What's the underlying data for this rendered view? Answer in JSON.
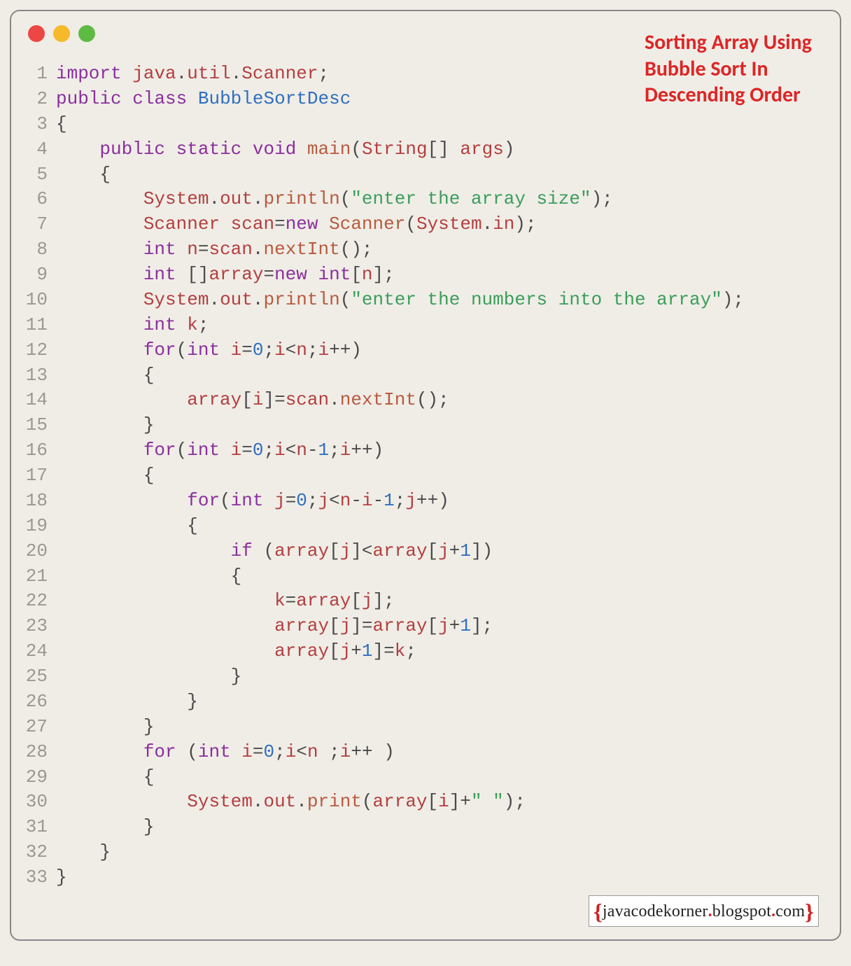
{
  "title_lines": [
    "Sorting Array Using",
    "Bubble Sort In",
    "Descending Order"
  ],
  "footer": {
    "open": "{",
    "text1": "javacodekorner",
    "dot": ".",
    "text2": "blogspot",
    "text3": "com",
    "close": "}"
  },
  "code": [
    {
      "n": "1",
      "tokens": [
        [
          "kw",
          "import"
        ],
        [
          "plain",
          " "
        ],
        [
          "ident",
          "java"
        ],
        [
          "punc",
          "."
        ],
        [
          "ident",
          "util"
        ],
        [
          "punc",
          "."
        ],
        [
          "ident",
          "Scanner"
        ],
        [
          "punc",
          ";"
        ]
      ]
    },
    {
      "n": "2",
      "tokens": [
        [
          "kw",
          "public"
        ],
        [
          "plain",
          " "
        ],
        [
          "kw",
          "class"
        ],
        [
          "plain",
          " "
        ],
        [
          "cls",
          "BubbleSortDesc"
        ]
      ]
    },
    {
      "n": "3",
      "tokens": [
        [
          "punc",
          "{"
        ]
      ]
    },
    {
      "n": "4",
      "tokens": [
        [
          "plain",
          "    "
        ],
        [
          "kw",
          "public"
        ],
        [
          "plain",
          " "
        ],
        [
          "kw",
          "static"
        ],
        [
          "plain",
          " "
        ],
        [
          "kw",
          "void"
        ],
        [
          "plain",
          " "
        ],
        [
          "fn",
          "main"
        ],
        [
          "punc",
          "("
        ],
        [
          "ident",
          "String"
        ],
        [
          "punc",
          "[] "
        ],
        [
          "ident",
          "args"
        ],
        [
          "punc",
          ")"
        ]
      ]
    },
    {
      "n": "5",
      "tokens": [
        [
          "plain",
          "    "
        ],
        [
          "punc",
          "{"
        ]
      ]
    },
    {
      "n": "6",
      "tokens": [
        [
          "plain",
          "        "
        ],
        [
          "ident",
          "System"
        ],
        [
          "punc",
          "."
        ],
        [
          "ident",
          "out"
        ],
        [
          "punc",
          "."
        ],
        [
          "fn",
          "println"
        ],
        [
          "punc",
          "("
        ],
        [
          "str",
          "\"enter the array size\""
        ],
        [
          "punc",
          ");"
        ]
      ]
    },
    {
      "n": "7",
      "tokens": [
        [
          "plain",
          "        "
        ],
        [
          "ident",
          "Scanner"
        ],
        [
          "plain",
          " "
        ],
        [
          "ident",
          "scan"
        ],
        [
          "op",
          "="
        ],
        [
          "kw",
          "new"
        ],
        [
          "plain",
          " "
        ],
        [
          "fn",
          "Scanner"
        ],
        [
          "punc",
          "("
        ],
        [
          "ident",
          "System"
        ],
        [
          "punc",
          "."
        ],
        [
          "ident",
          "in"
        ],
        [
          "punc",
          ");"
        ]
      ]
    },
    {
      "n": "8",
      "tokens": [
        [
          "plain",
          "        "
        ],
        [
          "kw",
          "int"
        ],
        [
          "plain",
          " "
        ],
        [
          "ident",
          "n"
        ],
        [
          "op",
          "="
        ],
        [
          "ident",
          "scan"
        ],
        [
          "punc",
          "."
        ],
        [
          "fn",
          "nextInt"
        ],
        [
          "punc",
          "();"
        ]
      ]
    },
    {
      "n": "9",
      "tokens": [
        [
          "plain",
          "        "
        ],
        [
          "kw",
          "int"
        ],
        [
          "plain",
          " []"
        ],
        [
          "ident",
          "array"
        ],
        [
          "op",
          "="
        ],
        [
          "kw",
          "new"
        ],
        [
          "plain",
          " "
        ],
        [
          "kw",
          "int"
        ],
        [
          "punc",
          "["
        ],
        [
          "ident",
          "n"
        ],
        [
          "punc",
          "];"
        ]
      ]
    },
    {
      "n": "10",
      "tokens": [
        [
          "plain",
          "        "
        ],
        [
          "ident",
          "System"
        ],
        [
          "punc",
          "."
        ],
        [
          "ident",
          "out"
        ],
        [
          "punc",
          "."
        ],
        [
          "fn",
          "println"
        ],
        [
          "punc",
          "("
        ],
        [
          "str",
          "\"enter the numbers into the array\""
        ],
        [
          "punc",
          ");"
        ]
      ]
    },
    {
      "n": "11",
      "tokens": [
        [
          "plain",
          "        "
        ],
        [
          "kw",
          "int"
        ],
        [
          "plain",
          " "
        ],
        [
          "ident",
          "k"
        ],
        [
          "punc",
          ";"
        ]
      ]
    },
    {
      "n": "12",
      "tokens": [
        [
          "plain",
          "        "
        ],
        [
          "kw",
          "for"
        ],
        [
          "punc",
          "("
        ],
        [
          "kw",
          "int"
        ],
        [
          "plain",
          " "
        ],
        [
          "ident",
          "i"
        ],
        [
          "op",
          "="
        ],
        [
          "num",
          "0"
        ],
        [
          "punc",
          ";"
        ],
        [
          "ident",
          "i"
        ],
        [
          "op",
          "<"
        ],
        [
          "ident",
          "n"
        ],
        [
          "punc",
          ";"
        ],
        [
          "ident",
          "i"
        ],
        [
          "op",
          "++"
        ],
        [
          "punc",
          ")"
        ]
      ]
    },
    {
      "n": "13",
      "tokens": [
        [
          "plain",
          "        "
        ],
        [
          "punc",
          "{"
        ]
      ]
    },
    {
      "n": "14",
      "tokens": [
        [
          "plain",
          "            "
        ],
        [
          "ident",
          "array"
        ],
        [
          "punc",
          "["
        ],
        [
          "ident",
          "i"
        ],
        [
          "punc",
          "]"
        ],
        [
          "op",
          "="
        ],
        [
          "ident",
          "scan"
        ],
        [
          "punc",
          "."
        ],
        [
          "fn",
          "nextInt"
        ],
        [
          "punc",
          "();"
        ]
      ]
    },
    {
      "n": "15",
      "tokens": [
        [
          "plain",
          "        "
        ],
        [
          "punc",
          "}"
        ]
      ]
    },
    {
      "n": "16",
      "tokens": [
        [
          "plain",
          "        "
        ],
        [
          "kw",
          "for"
        ],
        [
          "punc",
          "("
        ],
        [
          "kw",
          "int"
        ],
        [
          "plain",
          " "
        ],
        [
          "ident",
          "i"
        ],
        [
          "op",
          "="
        ],
        [
          "num",
          "0"
        ],
        [
          "punc",
          ";"
        ],
        [
          "ident",
          "i"
        ],
        [
          "op",
          "<"
        ],
        [
          "ident",
          "n"
        ],
        [
          "op",
          "-"
        ],
        [
          "num",
          "1"
        ],
        [
          "punc",
          ";"
        ],
        [
          "ident",
          "i"
        ],
        [
          "op",
          "++"
        ],
        [
          "punc",
          ")"
        ]
      ]
    },
    {
      "n": "17",
      "tokens": [
        [
          "plain",
          "        "
        ],
        [
          "punc",
          "{"
        ]
      ]
    },
    {
      "n": "18",
      "tokens": [
        [
          "plain",
          "            "
        ],
        [
          "kw",
          "for"
        ],
        [
          "punc",
          "("
        ],
        [
          "kw",
          "int"
        ],
        [
          "plain",
          " "
        ],
        [
          "ident",
          "j"
        ],
        [
          "op",
          "="
        ],
        [
          "num",
          "0"
        ],
        [
          "punc",
          ";"
        ],
        [
          "ident",
          "j"
        ],
        [
          "op",
          "<"
        ],
        [
          "ident",
          "n"
        ],
        [
          "op",
          "-"
        ],
        [
          "ident",
          "i"
        ],
        [
          "op",
          "-"
        ],
        [
          "num",
          "1"
        ],
        [
          "punc",
          ";"
        ],
        [
          "ident",
          "j"
        ],
        [
          "op",
          "++"
        ],
        [
          "punc",
          ")"
        ]
      ]
    },
    {
      "n": "19",
      "tokens": [
        [
          "plain",
          "            "
        ],
        [
          "punc",
          "{"
        ]
      ]
    },
    {
      "n": "20",
      "tokens": [
        [
          "plain",
          "                "
        ],
        [
          "kw",
          "if"
        ],
        [
          "plain",
          " "
        ],
        [
          "punc",
          "("
        ],
        [
          "ident",
          "array"
        ],
        [
          "punc",
          "["
        ],
        [
          "ident",
          "j"
        ],
        [
          "punc",
          "]"
        ],
        [
          "op",
          "<"
        ],
        [
          "ident",
          "array"
        ],
        [
          "punc",
          "["
        ],
        [
          "ident",
          "j"
        ],
        [
          "op",
          "+"
        ],
        [
          "num",
          "1"
        ],
        [
          "punc",
          "])"
        ]
      ]
    },
    {
      "n": "21",
      "tokens": [
        [
          "plain",
          "                "
        ],
        [
          "punc",
          "{"
        ]
      ]
    },
    {
      "n": "22",
      "tokens": [
        [
          "plain",
          "                    "
        ],
        [
          "ident",
          "k"
        ],
        [
          "op",
          "="
        ],
        [
          "ident",
          "array"
        ],
        [
          "punc",
          "["
        ],
        [
          "ident",
          "j"
        ],
        [
          "punc",
          "];"
        ]
      ]
    },
    {
      "n": "23",
      "tokens": [
        [
          "plain",
          "                    "
        ],
        [
          "ident",
          "array"
        ],
        [
          "punc",
          "["
        ],
        [
          "ident",
          "j"
        ],
        [
          "punc",
          "]"
        ],
        [
          "op",
          "="
        ],
        [
          "ident",
          "array"
        ],
        [
          "punc",
          "["
        ],
        [
          "ident",
          "j"
        ],
        [
          "op",
          "+"
        ],
        [
          "num",
          "1"
        ],
        [
          "punc",
          "];"
        ]
      ]
    },
    {
      "n": "24",
      "tokens": [
        [
          "plain",
          "                    "
        ],
        [
          "ident",
          "array"
        ],
        [
          "punc",
          "["
        ],
        [
          "ident",
          "j"
        ],
        [
          "op",
          "+"
        ],
        [
          "num",
          "1"
        ],
        [
          "punc",
          "]"
        ],
        [
          "op",
          "="
        ],
        [
          "ident",
          "k"
        ],
        [
          "punc",
          ";"
        ]
      ]
    },
    {
      "n": "25",
      "tokens": [
        [
          "plain",
          "                "
        ],
        [
          "punc",
          "}"
        ]
      ]
    },
    {
      "n": "26",
      "tokens": [
        [
          "plain",
          "            "
        ],
        [
          "punc",
          "}"
        ]
      ]
    },
    {
      "n": "27",
      "tokens": [
        [
          "plain",
          "        "
        ],
        [
          "punc",
          "}"
        ]
      ]
    },
    {
      "n": "28",
      "tokens": [
        [
          "plain",
          "        "
        ],
        [
          "kw",
          "for"
        ],
        [
          "plain",
          " "
        ],
        [
          "punc",
          "("
        ],
        [
          "kw",
          "int"
        ],
        [
          "plain",
          " "
        ],
        [
          "ident",
          "i"
        ],
        [
          "op",
          "="
        ],
        [
          "num",
          "0"
        ],
        [
          "punc",
          ";"
        ],
        [
          "ident",
          "i"
        ],
        [
          "op",
          "<"
        ],
        [
          "ident",
          "n"
        ],
        [
          "plain",
          " "
        ],
        [
          "punc",
          ";"
        ],
        [
          "ident",
          "i"
        ],
        [
          "op",
          "++"
        ],
        [
          "plain",
          " "
        ],
        [
          "punc",
          ")"
        ]
      ]
    },
    {
      "n": "29",
      "tokens": [
        [
          "plain",
          "        "
        ],
        [
          "punc",
          "{"
        ]
      ]
    },
    {
      "n": "30",
      "tokens": [
        [
          "plain",
          "            "
        ],
        [
          "ident",
          "System"
        ],
        [
          "punc",
          "."
        ],
        [
          "ident",
          "out"
        ],
        [
          "punc",
          "."
        ],
        [
          "fn",
          "print"
        ],
        [
          "punc",
          "("
        ],
        [
          "ident",
          "array"
        ],
        [
          "punc",
          "["
        ],
        [
          "ident",
          "i"
        ],
        [
          "punc",
          "]"
        ],
        [
          "op",
          "+"
        ],
        [
          "str",
          "\" \""
        ],
        [
          "punc",
          ");"
        ]
      ]
    },
    {
      "n": "31",
      "tokens": [
        [
          "plain",
          "        "
        ],
        [
          "punc",
          "}"
        ]
      ]
    },
    {
      "n": "32",
      "tokens": [
        [
          "plain",
          "    "
        ],
        [
          "punc",
          "}"
        ]
      ]
    },
    {
      "n": "33",
      "tokens": [
        [
          "punc",
          "}"
        ]
      ]
    }
  ]
}
